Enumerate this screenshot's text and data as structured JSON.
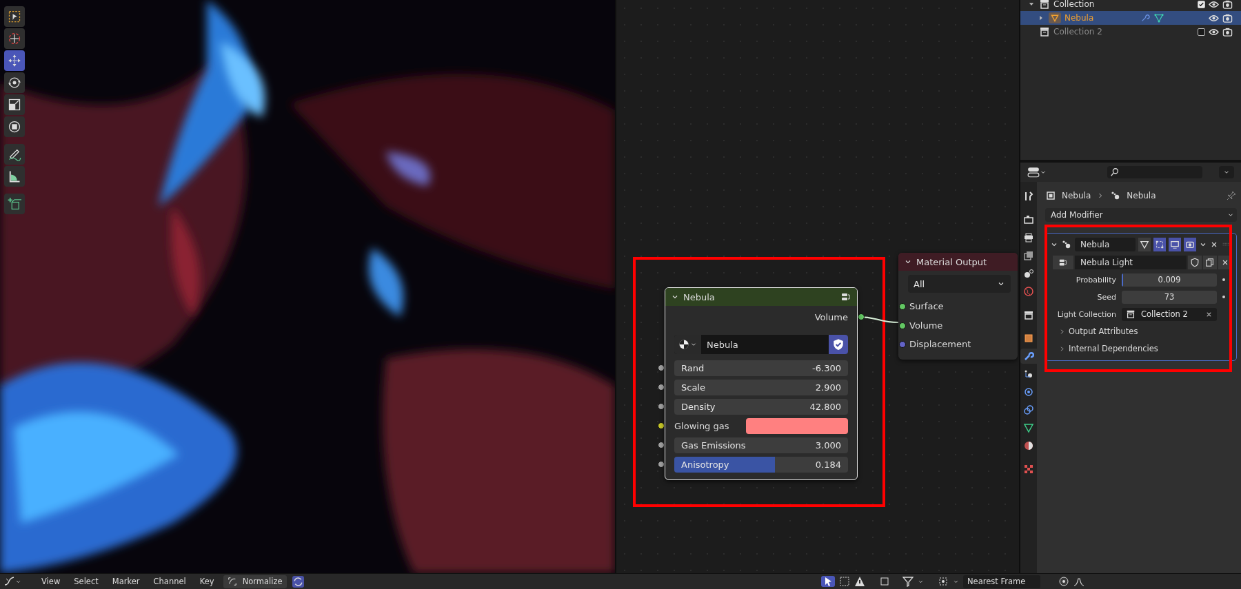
{
  "viewport": {
    "tools": [
      {
        "kind": "select",
        "selected": false
      },
      {
        "kind": "cursor",
        "selected": false
      },
      {
        "kind": "move",
        "selected": true
      },
      {
        "kind": "rotate",
        "selected": false
      },
      {
        "kind": "scale",
        "selected": false
      },
      {
        "kind": "transform",
        "selected": false
      },
      {
        "kind": "annotate",
        "selected": false
      },
      {
        "kind": "measure",
        "selected": false
      },
      {
        "kind": "add_cube",
        "selected": false
      }
    ]
  },
  "group_node": {
    "title": "Nebula",
    "output": "Volume",
    "datablock": {
      "name": "Nebula",
      "fake_user": true
    },
    "inputs": [
      {
        "kind": "value",
        "label": "Rand",
        "value": "-6.300"
      },
      {
        "kind": "value",
        "label": "Scale",
        "value": "2.900"
      },
      {
        "kind": "value",
        "label": "Density",
        "value": "42.800"
      },
      {
        "kind": "color",
        "label": "Glowing gas",
        "color": "#ff8080"
      },
      {
        "kind": "value",
        "label": "Gas Emissions",
        "value": "3.000"
      },
      {
        "kind": "slider",
        "label": "Anisotropy",
        "value": "0.184",
        "level": 0.58
      }
    ]
  },
  "output_node": {
    "title": "Material Output",
    "target": "All",
    "inputs": [
      {
        "label": "Surface",
        "color": "#63c763"
      },
      {
        "label": "Volume",
        "color": "#63c763"
      },
      {
        "label": "Displacement",
        "color": "#6363c7"
      }
    ]
  },
  "outliner": {
    "rows": [
      {
        "kind": "collection",
        "label": "Collection",
        "expanded": true,
        "checked": true,
        "selected": false,
        "children": [
          {
            "kind": "object",
            "label": "Nebula",
            "expanded": false,
            "selected": true
          }
        ]
      },
      {
        "kind": "collection",
        "label": "Collection 2",
        "checked": false,
        "selected": false
      }
    ]
  },
  "properties": {
    "tabs": [
      {
        "kind": "tool",
        "selected": false
      },
      {
        "kind": "render",
        "selected": false
      },
      {
        "kind": "output",
        "selected": false
      },
      {
        "kind": "view_layer",
        "selected": false
      },
      {
        "kind": "scene",
        "selected": false
      },
      {
        "kind": "world",
        "selected": false
      },
      {
        "kind": "collection",
        "selected": false
      },
      {
        "kind": "object",
        "selected": false
      },
      {
        "kind": "modifiers",
        "selected": true
      },
      {
        "kind": "particles",
        "selected": false
      },
      {
        "kind": "physics",
        "selected": false
      },
      {
        "kind": "constraints",
        "selected": false
      },
      {
        "kind": "data",
        "selected": false
      },
      {
        "kind": "material",
        "selected": false
      },
      {
        "kind": "texture",
        "selected": false
      }
    ],
    "breadcrumb": [
      "Nebula",
      "Nebula"
    ],
    "add_modifier": "Add Modifier",
    "modifier": {
      "expanded": true,
      "name": "Nebula",
      "toggles": [
        {
          "kind": "edit_mode",
          "on": false
        },
        {
          "kind": "cage",
          "on": true
        },
        {
          "kind": "viewport",
          "on": true
        },
        {
          "kind": "render",
          "on": true
        }
      ],
      "node_group": "Nebula Light",
      "fields": [
        {
          "kind": "slider",
          "label": "Probability",
          "value": "0.009",
          "level": 0.009
        },
        {
          "kind": "number",
          "label": "Seed",
          "value": "73"
        },
        {
          "kind": "collection",
          "label": "Light Collection",
          "value": "Collection 2"
        }
      ],
      "panels": [
        {
          "label": "Output Attributes",
          "expanded": false
        },
        {
          "label": "Internal Dependencies",
          "expanded": false
        }
      ]
    }
  },
  "timeline_header": {
    "menus": [
      "View",
      "Select",
      "Marker",
      "Channel",
      "Key"
    ],
    "normalize": {
      "label": "Normalize",
      "on": false
    },
    "snap": "Nearest Frame"
  }
}
